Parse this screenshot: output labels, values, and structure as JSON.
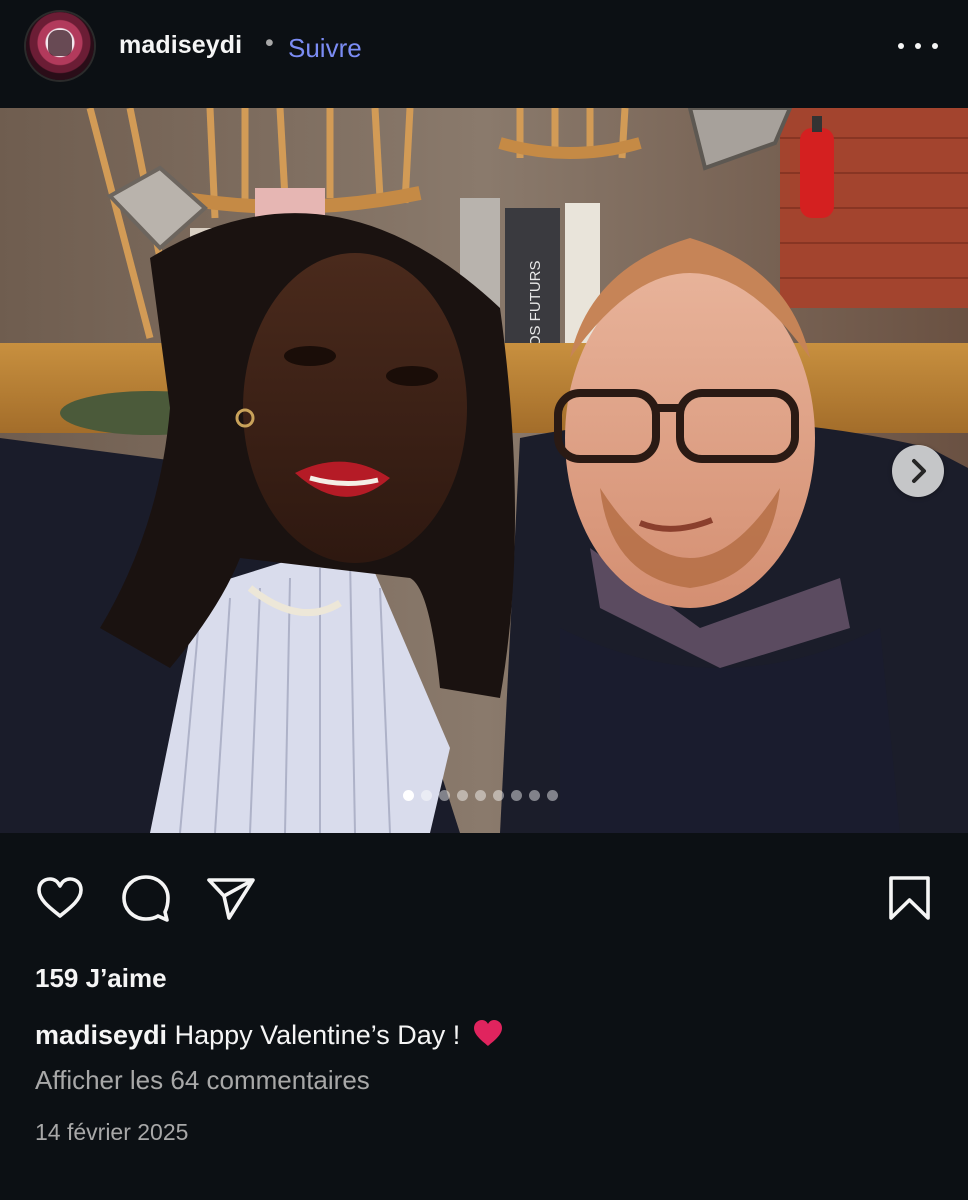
{
  "header": {
    "username": "madiseydi",
    "separator": "•",
    "follow_label": "Suivre",
    "avatar_icon": "profile-avatar",
    "more_icon": "more-horizontal-icon"
  },
  "post": {
    "image_alt": "",
    "carousel": {
      "total_slides": 9,
      "current_slide": 1,
      "next_icon": "chevron-right-icon"
    },
    "book_spine_text": "NOS FUTURS"
  },
  "actions": {
    "like_icon": "heart-outline-icon",
    "comment_icon": "speech-bubble-icon",
    "share_icon": "paper-plane-icon",
    "save_icon": "bookmark-outline-icon"
  },
  "likes_label": "159 J’aime",
  "caption": {
    "username": "madiseydi",
    "text": "Happy Valentine’s Day !",
    "emoji": "❤️",
    "emoji_color": "#e0245e"
  },
  "comments_link": "Afficher les 64 commentaires",
  "date": "14 février 2025",
  "colors": {
    "background": "#0c1014",
    "link_blue": "#7b8cf4",
    "secondary_text": "#a8a8a8",
    "primary_text": "#f5f5f5"
  }
}
